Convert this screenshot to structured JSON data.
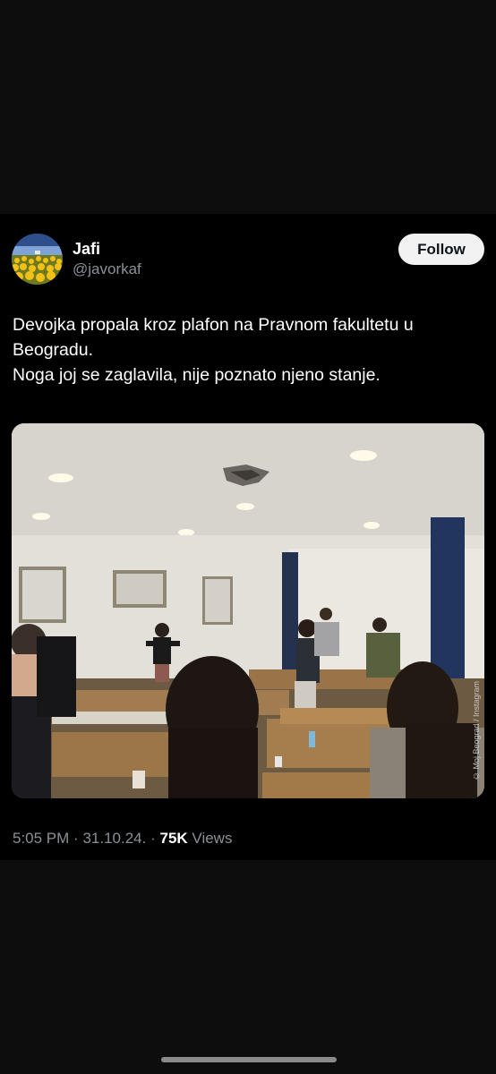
{
  "tweet": {
    "author": {
      "display_name": "Jafi",
      "handle": "@javorkaf",
      "avatar_icon": "sunflower-field-avatar"
    },
    "follow_label": "Follow",
    "text_lines": [
      "Devojka propala kroz plafon na Pravnom fakultetu u Beogradu.",
      "Noga joj se zaglavila, nije poznato njeno stanje."
    ],
    "media": {
      "watermark": "© Moj Beograd / Instagram"
    },
    "time": "5:05 PM",
    "date": "31.10.24.",
    "separator": "·",
    "views_count": "75K",
    "views_label": "Views"
  },
  "colors": {
    "background": "#0d0d0d",
    "card": "#000000",
    "secondary_text": "#8b9096",
    "follow_bg": "#f2f2f2"
  }
}
